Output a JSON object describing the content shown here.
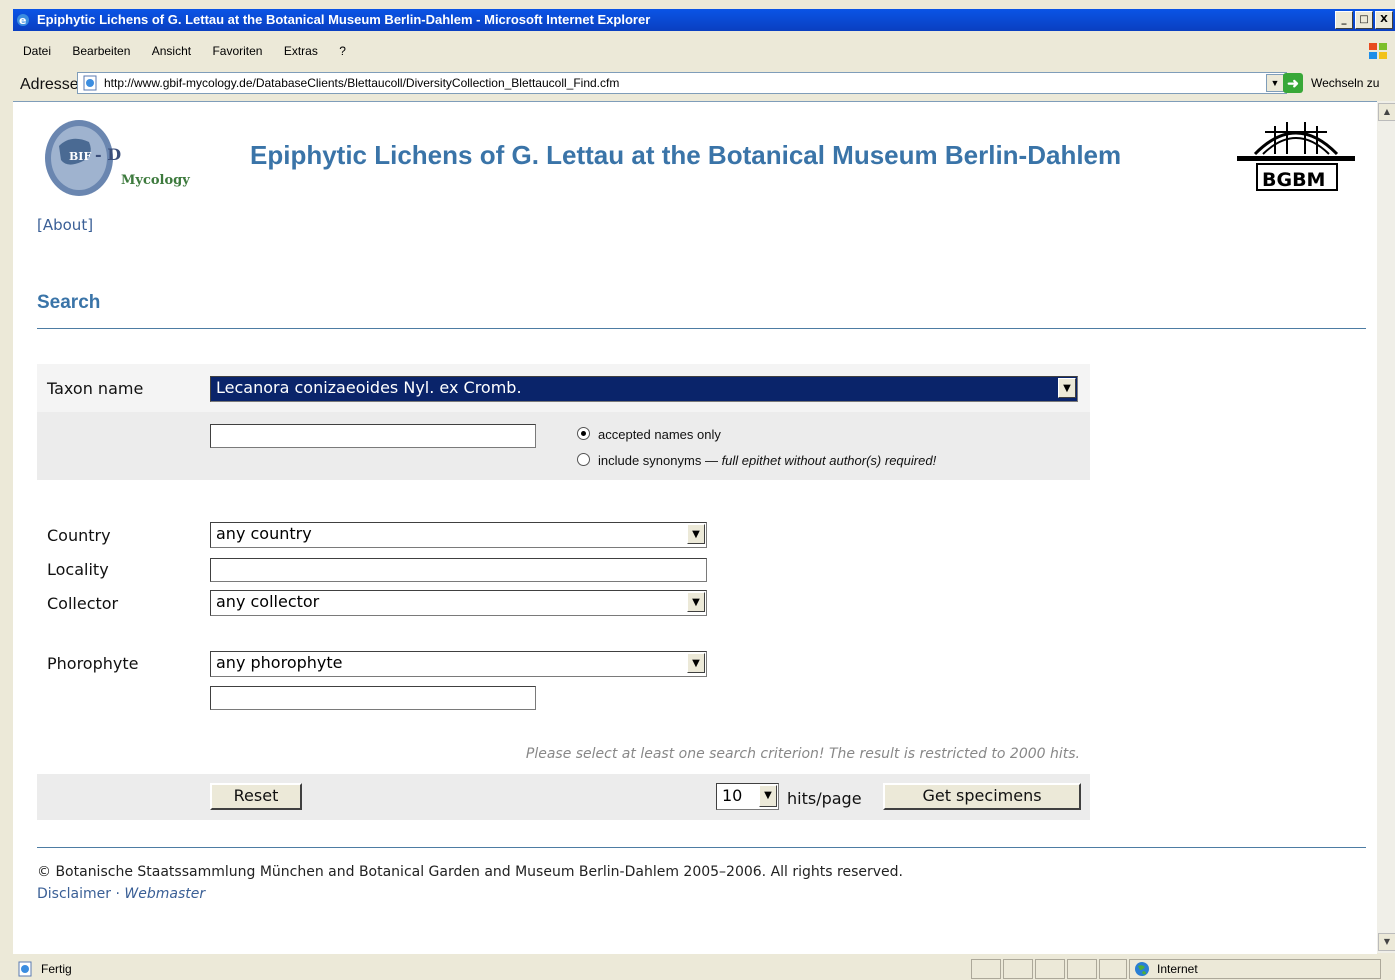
{
  "window": {
    "title": "Epiphytic Lichens of G. Lettau at the Botanical Museum Berlin-Dahlem - Microsoft Internet Explorer",
    "controls": [
      "_",
      "□",
      "X"
    ]
  },
  "menubar": [
    "Datei",
    "Bearbeiten",
    "Ansicht",
    "Favoriten",
    "Extras",
    "?"
  ],
  "addressbar": {
    "label": "Adresse",
    "url": "http://www.gbif-mycology.de/DatabaseClients/Blettaucoll/DiversityCollection_Blettaucoll_Find.cfm",
    "go_label": "Wechseln zu"
  },
  "header": {
    "logo_text": "GBIF-D Mycology",
    "title": "Epiphytic Lichens of G. Lettau at the Botanical Museum Berlin-Dahlem",
    "bgbm_logo_text": "BGBM"
  },
  "about_link": "[About]",
  "search_heading": "Search",
  "form": {
    "taxon_label": "Taxon name",
    "taxon_selected": "Lecanora conizaeoides Nyl. ex Cromb.",
    "taxon_text_value": "",
    "radio_accepted": "accepted names only",
    "radio_synonyms": "include synonyms — ",
    "radio_synonyms_note": "full epithet without author(s) required!",
    "country_label": "Country",
    "country_selected": "any country",
    "locality_label": "Locality",
    "locality_value": "",
    "collector_label": "Collector",
    "collector_selected": "any collector",
    "phorophyte_label": "Phorophyte",
    "phorophyte_selected": "any phorophyte",
    "phorophyte_text_value": "",
    "note": "Please select at least one search criterion! The result is restricted to 2000 hits.",
    "reset_label": "Reset",
    "hits_selected": "10",
    "hits_label": "hits/page",
    "submit_label": "Get specimens"
  },
  "footer": {
    "copyright": "© Botanische Staatssammlung München and Botanical Garden and Museum Berlin-Dahlem 2005–2006. All rights reserved.",
    "disclaimer": "Disclaimer",
    "separator": " · ",
    "webmaster": "Webmaster"
  },
  "statusbar": {
    "status": "Fertig",
    "zone": "Internet"
  },
  "colors": {
    "title_blue": "#3a74a8",
    "selection": "#0a246a",
    "band": "#ececec"
  }
}
